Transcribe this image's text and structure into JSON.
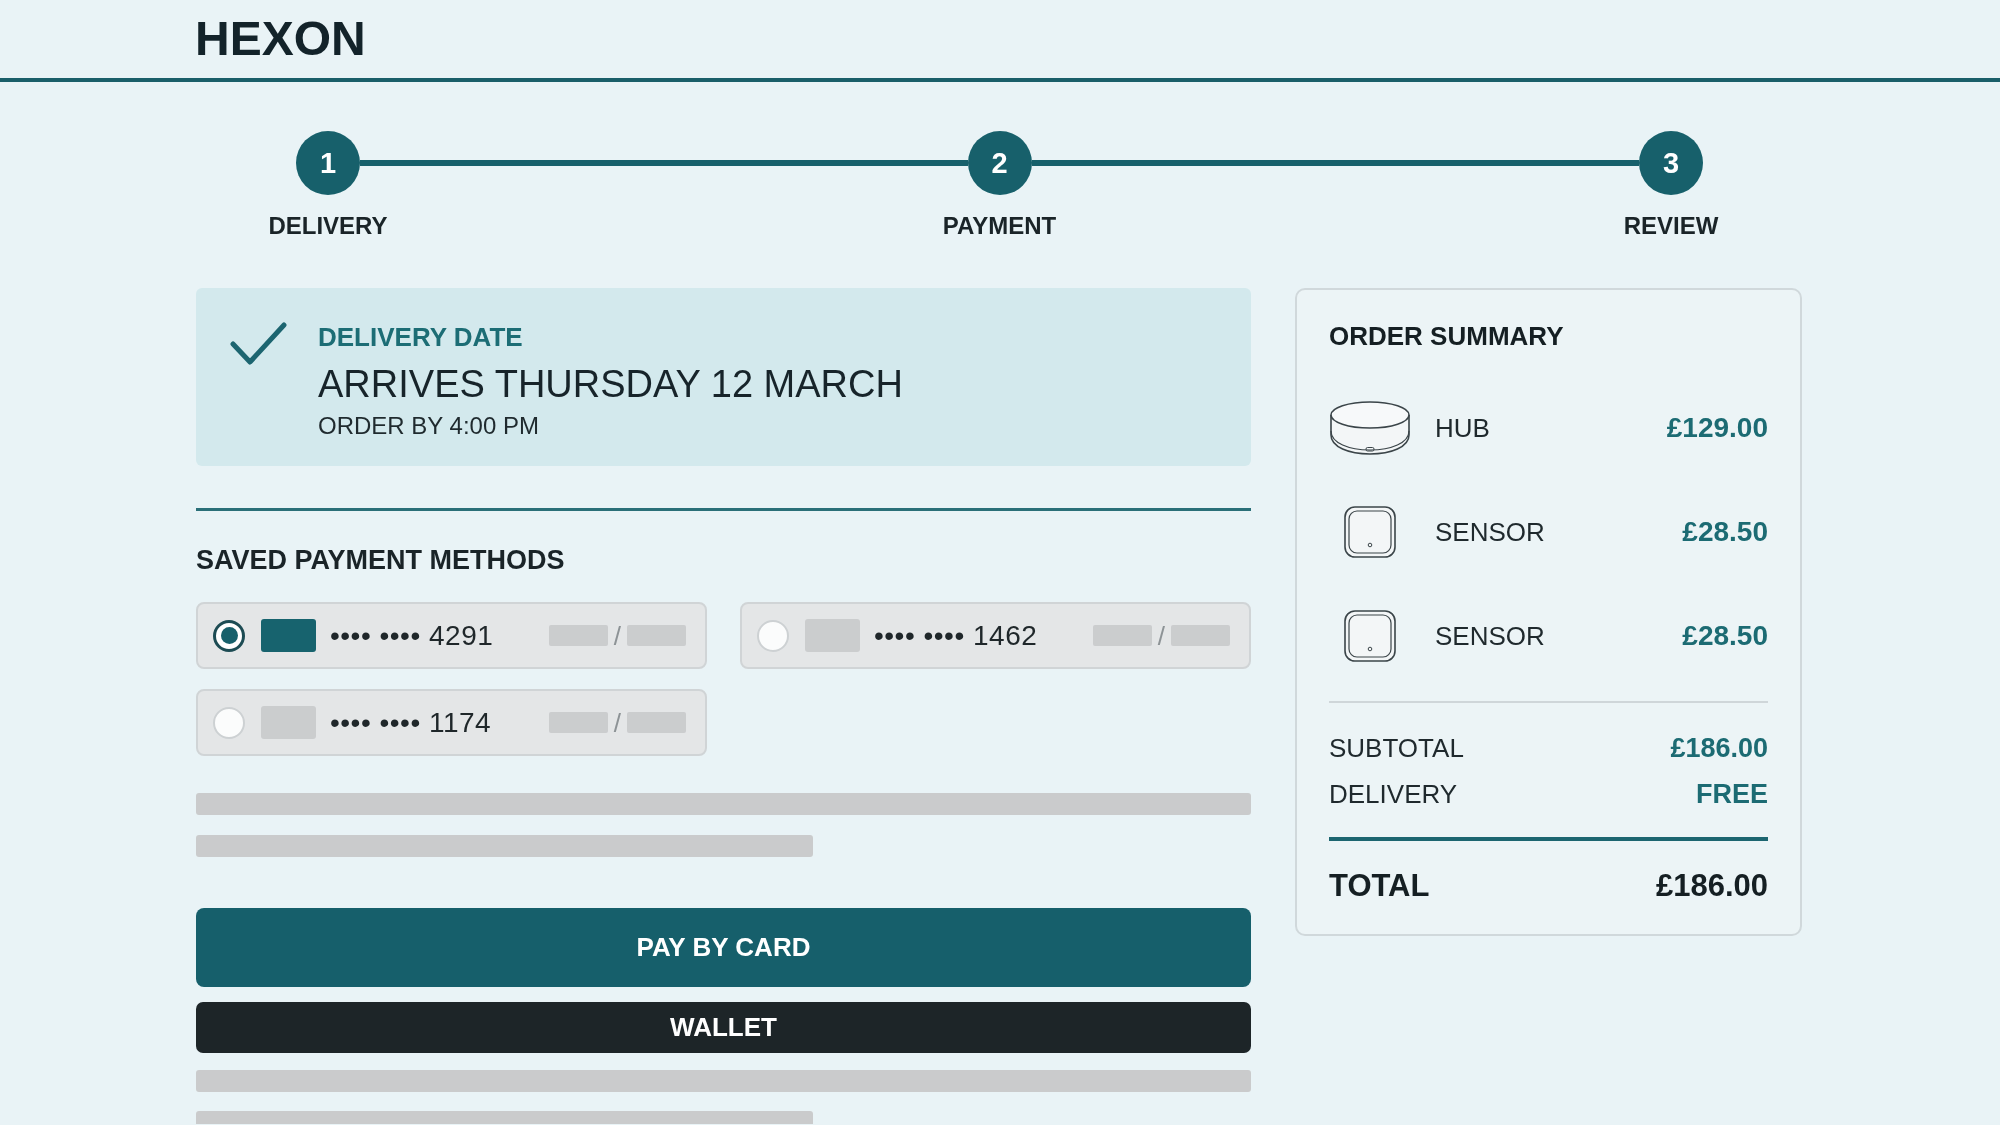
{
  "header": {
    "logo": "HEXON"
  },
  "stepper": {
    "steps": [
      {
        "number": "1",
        "label": "DELIVERY"
      },
      {
        "number": "2",
        "label": "PAYMENT"
      },
      {
        "number": "3",
        "label": "REVIEW"
      }
    ]
  },
  "delivery": {
    "title": "DELIVERY DATE",
    "headline": "ARRIVES THURSDAY 12 MARCH",
    "note": "ORDER BY 4:00 PM"
  },
  "payment_methods": {
    "title": "SAVED PAYMENT METHODS",
    "cards": [
      {
        "number": "•••• •••• 4291",
        "expiry_separator": "/",
        "selected": true
      },
      {
        "number": "•••• •••• 1462",
        "expiry_separator": "/",
        "selected": false
      },
      {
        "number": "•••• •••• 1174",
        "expiry_separator": "/",
        "selected": false
      }
    ]
  },
  "buttons": [
    {
      "kind": "primary",
      "label": "PAY BY CARD"
    },
    {
      "kind": "dark",
      "label": "WALLET"
    }
  ],
  "order_summary": {
    "title": "ORDER SUMMARY",
    "items": [
      {
        "kind": "hub",
        "name": "HUB",
        "price": "£129.00"
      },
      {
        "kind": "sensor",
        "name": "SENSOR",
        "price": "£28.50"
      },
      {
        "kind": "sensor",
        "name": "SENSOR",
        "price": "£28.50"
      }
    ],
    "subtotal": {
      "label": "SUBTOTAL",
      "value": "£186.00"
    },
    "delivery": {
      "label": "DELIVERY",
      "value": "FREE"
    },
    "total": {
      "label": "TOTAL",
      "value": "£186.00"
    }
  }
}
